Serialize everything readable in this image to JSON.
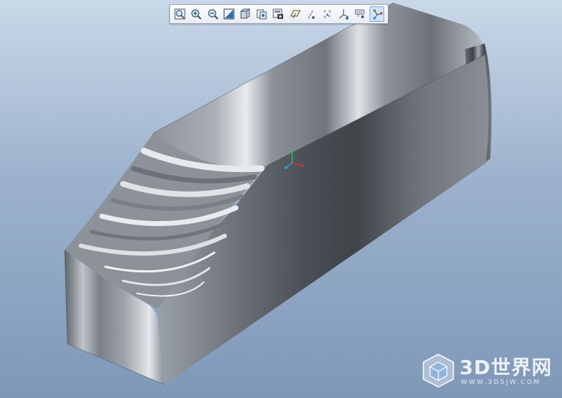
{
  "toolbar": {
    "buttons": [
      {
        "name": "zoom-fit-icon"
      },
      {
        "name": "zoom-in-icon"
      },
      {
        "name": "zoom-out-icon"
      },
      {
        "name": "repaint-icon"
      },
      {
        "name": "display-style-icon"
      },
      {
        "name": "saved-views-icon"
      },
      {
        "name": "view-manager-icon"
      },
      {
        "name": "datum-planes-icon"
      },
      {
        "name": "datum-axes-icon"
      },
      {
        "name": "datum-points-icon"
      },
      {
        "name": "coordinate-systems-icon"
      },
      {
        "name": "annotations-icon"
      },
      {
        "name": "spin-center-icon",
        "active": true
      }
    ]
  },
  "watermark": {
    "logo": "3d-cube-logo",
    "title": "3D世界网",
    "url": "WWW.3DSJW.COM"
  },
  "colors": {
    "background_top": "#c9d8e8",
    "background_bottom": "#7f98b8",
    "model_gray": "#7a7f87",
    "axis_x": "#e03030",
    "axis_y": "#30c040",
    "axis_z": "#30a0e0"
  }
}
